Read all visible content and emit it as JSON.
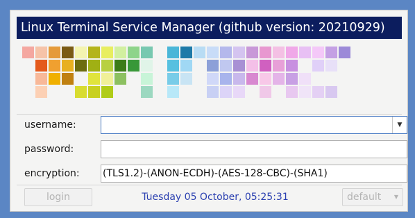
{
  "window": {
    "title": "Linux Terminal Service Manager (github version: 20210929)"
  },
  "form": {
    "username_label": "username:",
    "username_value": "",
    "password_label": "password:",
    "password_value": "",
    "encryption_label": "encryption:",
    "encryption_value": "(TLS1.2)-(ANON-ECDH)-(AES-128-CBC)-(SHA1)"
  },
  "footer": {
    "login_label": "login",
    "datetime": "Tuesday 05 October, 05:25:31",
    "profile_select": "default"
  },
  "colors": {
    "title_bar": "#0c1d5e",
    "desktop": "#5b86c4",
    "datetime_text": "#2a3fb0"
  },
  "icons": {
    "dropdown": "chevron-down-icon"
  }
}
